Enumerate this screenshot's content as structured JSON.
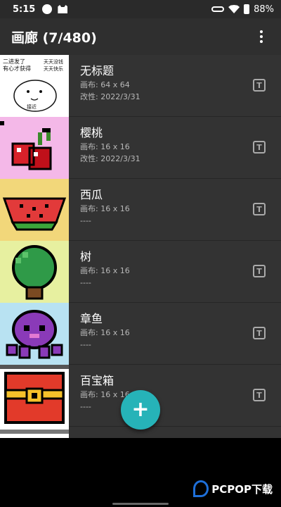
{
  "status_bar": {
    "time": "5:15",
    "battery": "88%"
  },
  "app_bar": {
    "title": "画廊 (7/480)",
    "menu_icon": "overflow-menu-icon"
  },
  "items": [
    {
      "title": "无标题",
      "canvas": "画布: 64 x 64",
      "modified": "改性: 2022/3/31"
    },
    {
      "title": "樱桃",
      "canvas": "画布: 16 x 16",
      "modified": "改性: 2022/3/31"
    },
    {
      "title": "西瓜",
      "canvas": "画布: 16 x 16",
      "modified": "----"
    },
    {
      "title": "树",
      "canvas": "画布: 16 x 16",
      "modified": "----"
    },
    {
      "title": "章鱼",
      "canvas": "画布: 16 x 16",
      "modified": "----"
    },
    {
      "title": "百宝箱",
      "canvas": "画布: 16 x 16",
      "modified": "----"
    }
  ],
  "thumb_text": {
    "line1": "二进发了",
    "line2": "有心才获得",
    "line3": "天天没钱",
    "line4": "天天快乐",
    "line5": "接近"
  },
  "rename_icon_label": "T",
  "fab": {
    "label": "+",
    "icon": "add-icon"
  },
  "watermark": {
    "text": "PCPOP下载"
  },
  "colors": {
    "accent": "#26b3b8",
    "list_bg": "#333333",
    "app_bar": "#2f2f2f"
  }
}
